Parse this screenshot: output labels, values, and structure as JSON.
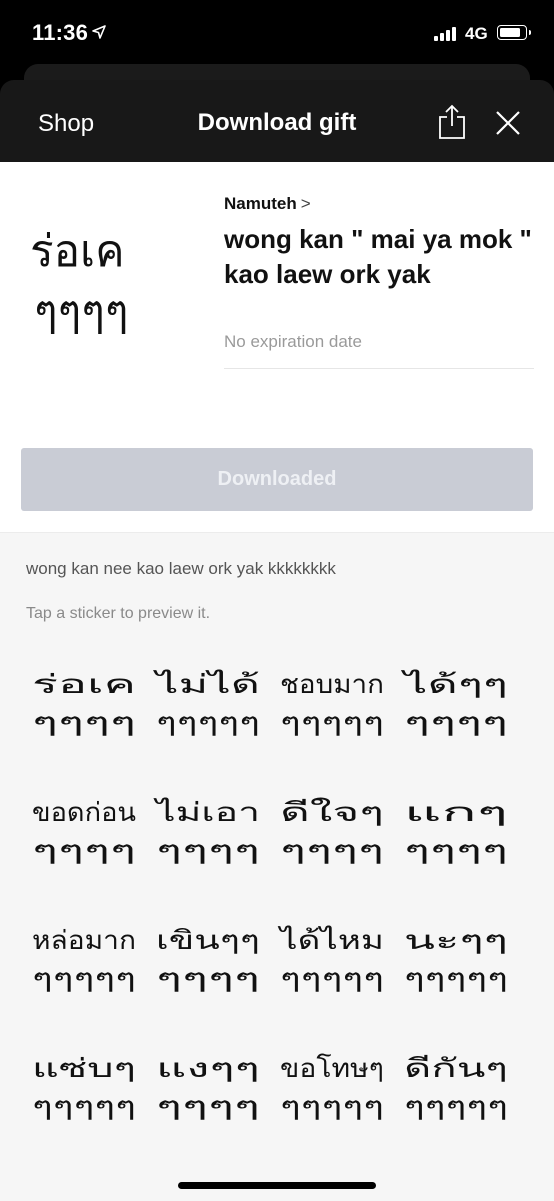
{
  "status_bar": {
    "time": "11:36",
    "network": "4G"
  },
  "header": {
    "shop_label": "Shop",
    "title": "Download gift"
  },
  "pack": {
    "author": "Namuteh",
    "title": "wong kan \" mai ya mok \" kao laew ork yak",
    "expiry": "No expiration date",
    "button_label": "Downloaded"
  },
  "description": "wong kan nee kao laew ork yak kkkkkkkk",
  "hint": "Tap a sticker to preview it.",
  "main_sticker": {
    "line1": "ร่อเค",
    "line2": "ๆๆๆๆ"
  },
  "stickers": [
    {
      "line1": "ร่อเค",
      "line2": "ๆๆๆๆ"
    },
    {
      "line1": "ไม่ได้",
      "line2": "ๆๆๆๆๆ"
    },
    {
      "line1": "ชอบมาก",
      "line2": "ๆๆๆๆๆ"
    },
    {
      "line1": "ได้ๆๆ",
      "line2": "ๆๆๆๆ"
    },
    {
      "line1": "ขอดก่อน",
      "line2": "ๆๆๆๆ"
    },
    {
      "line1": "ไม่เอา",
      "line2": "ๆๆๆๆ"
    },
    {
      "line1": "ดีใจๆ",
      "line2": "ๆๆๆๆ"
    },
    {
      "line1": "แกๆ",
      "line2": "ๆๆๆๆ"
    },
    {
      "line1": "หล่อมาก",
      "line2": "ๆๆๆๆๆ"
    },
    {
      "line1": "เขินๆๆ",
      "line2": "ๆๆๆๆ"
    },
    {
      "line1": "ได้ไหม",
      "line2": "ๆๆๆๆๆ"
    },
    {
      "line1": "นะๆๆ",
      "line2": "ๆๆๆๆๆ"
    },
    {
      "line1": "แซ่บๆ",
      "line2": "ๆๆๆๆๆ"
    },
    {
      "line1": "แงๆๆ",
      "line2": "ๆๆๆๆ"
    },
    {
      "line1": "ขอโทษๆ",
      "line2": "ๆๆๆๆๆ"
    },
    {
      "line1": "ดีกันๆ",
      "line2": "ๆๆๆๆๆ"
    }
  ]
}
